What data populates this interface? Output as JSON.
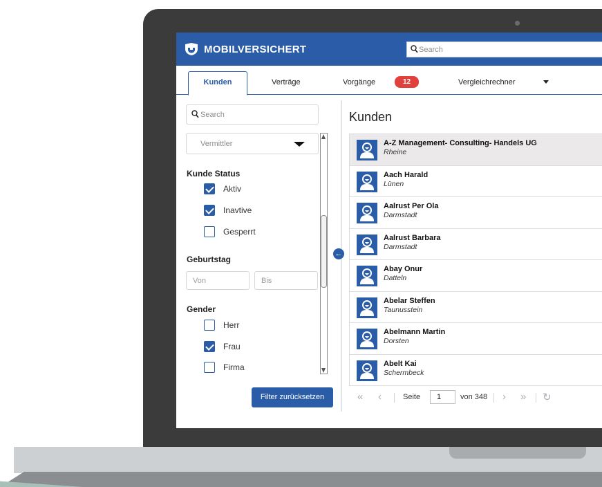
{
  "app": {
    "brand": "MOBILVERSICHERT",
    "search_placeholder": "Search"
  },
  "tabs": [
    {
      "label": "Kunden",
      "active": true
    },
    {
      "label": "Verträge"
    },
    {
      "label": "Vorgänge",
      "badge": "12"
    },
    {
      "label": "Vergleichrechner",
      "dropdown": true
    }
  ],
  "filters": {
    "search_placeholder": "Search",
    "vermittler_placeholder": "Vermittler",
    "status_title": "Kunde Status",
    "status": [
      {
        "label": "Aktiv",
        "checked": true
      },
      {
        "label": "Inavtive",
        "checked": true
      },
      {
        "label": "Gesperrt",
        "checked": false
      }
    ],
    "birthday_title": "Geburtstag",
    "from_placeholder": "Von",
    "to_placeholder": "Bis",
    "gender_title": "Gender",
    "gender": [
      {
        "label": "Herr",
        "checked": false
      },
      {
        "label": "Frau",
        "checked": true
      },
      {
        "label": "Firma",
        "checked": false
      }
    ],
    "reset_label": "Filter zurücksetzen"
  },
  "list": {
    "title": "Kunden",
    "rows": [
      {
        "name": "A-Z Management- Consulting- Handels UG",
        "city": "Rheine",
        "selected": true
      },
      {
        "name": "Aach Harald",
        "city": "Lünen"
      },
      {
        "name": "Aalrust Per Ola",
        "city": "Darmstadt"
      },
      {
        "name": "Aalrust Barbara",
        "city": "Darmstadt"
      },
      {
        "name": "Abay Onur",
        "city": "Datteln"
      },
      {
        "name": "Abelar Steffen",
        "city": "Taunusstein"
      },
      {
        "name": "Abelmann Martin",
        "city": "Dorsten"
      },
      {
        "name": "Abelt Kai",
        "city": "Schermbeck"
      }
    ]
  },
  "pager": {
    "page_label": "Seite",
    "page": "1",
    "total_label": "von 348"
  },
  "colors": {
    "brand_blue": "#2a5ca8",
    "badge_red": "#e0413c",
    "bezel": "#3b3b3c"
  }
}
